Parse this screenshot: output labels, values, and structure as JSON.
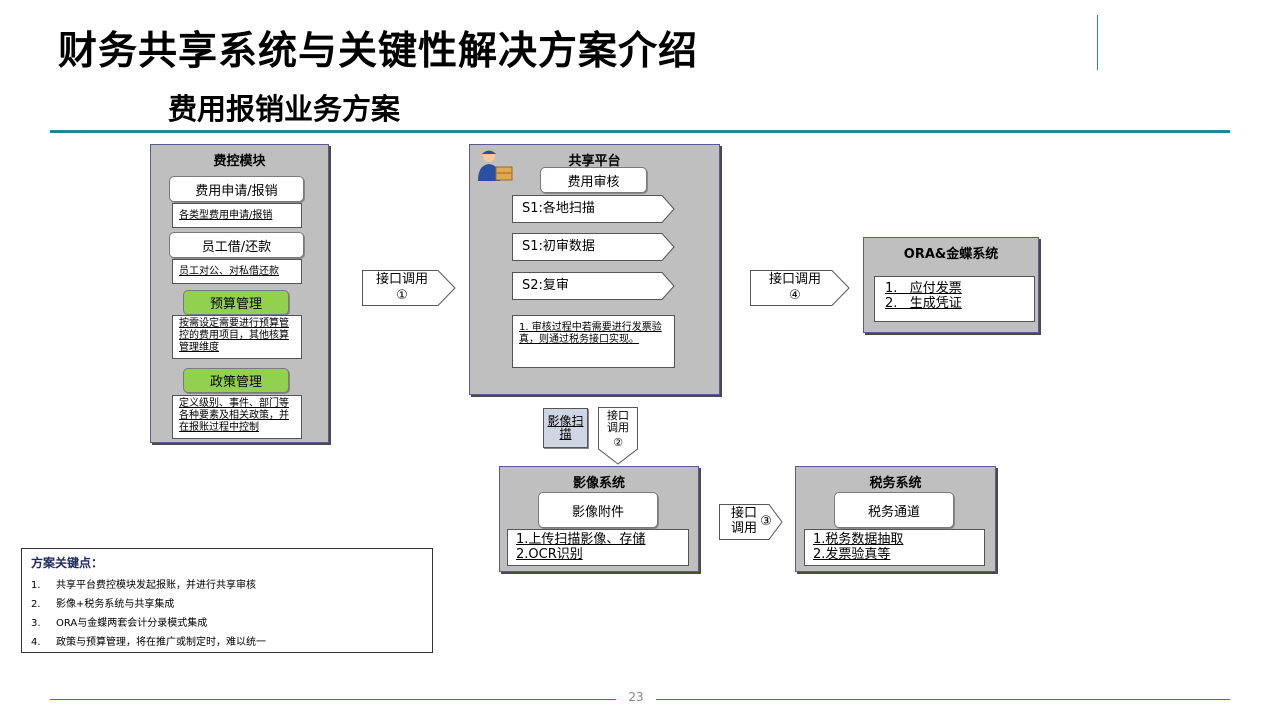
{
  "header": {
    "title": "财务共享系统与关键性解决方案介绍",
    "subtitle": "费用报销业务方案"
  },
  "fee_module": {
    "title": "费控模块",
    "items": [
      {
        "label": "费用申请/报销",
        "desc": "各类型费用申请/报销"
      },
      {
        "label": "员工借/还款",
        "desc": "员工对公、对私借还款"
      },
      {
        "label": "预算管理",
        "desc": "按需设定需要进行预算管控的费用项目，其他核算管理维度"
      },
      {
        "label": "政策管理",
        "desc": "定义级别、事件、部门等各种要素及相关政策，并在报账过程中控制"
      }
    ]
  },
  "share_platform": {
    "title": "共享平台",
    "audit_label": "费用审核",
    "steps": [
      "S1:各地扫描",
      "S1:初审数据",
      "S2:复审"
    ],
    "note": "1. 审核过程中若需要进行发票验真，则通过税务接口实现。"
  },
  "interfaces": {
    "i1": {
      "label": "接口调用",
      "num": "①"
    },
    "i2": {
      "label": "接口调用",
      "num": "②"
    },
    "i3": {
      "label": "接口调用",
      "num": "③"
    },
    "i4": {
      "label": "接口调用",
      "num": "④"
    },
    "scan": "影像扫描"
  },
  "ora": {
    "title": "ORA&金蝶系统",
    "items": [
      "1.   应付发票",
      "2.   生成凭证"
    ]
  },
  "image_sys": {
    "title": "影像系统",
    "attach_label": "影像附件",
    "items": [
      "1.上传扫描影像、存储",
      "2.OCR识别"
    ]
  },
  "tax_sys": {
    "title": "税务系统",
    "channel_label": "税务通道",
    "items": [
      "1.税务数据抽取",
      "2.发票验真等"
    ]
  },
  "key_points": {
    "title": "方案关键点：",
    "items": [
      {
        "num": "1.",
        "text": "共享平台费控模块发起报账，并进行共享审核"
      },
      {
        "num": "2.",
        "text": "影像+税务系统与共享集成"
      },
      {
        "num": "3.",
        "text": "ORA与金蝶两套会计分录模式集成"
      },
      {
        "num": "4.",
        "text": "政策与预算管理，将在推广或制定时，难以统一"
      }
    ]
  },
  "footer": {
    "page": "23"
  },
  "colors": {
    "accent": "#1f8a8a",
    "panel": "#bfbfbf",
    "green": "#92d050"
  }
}
